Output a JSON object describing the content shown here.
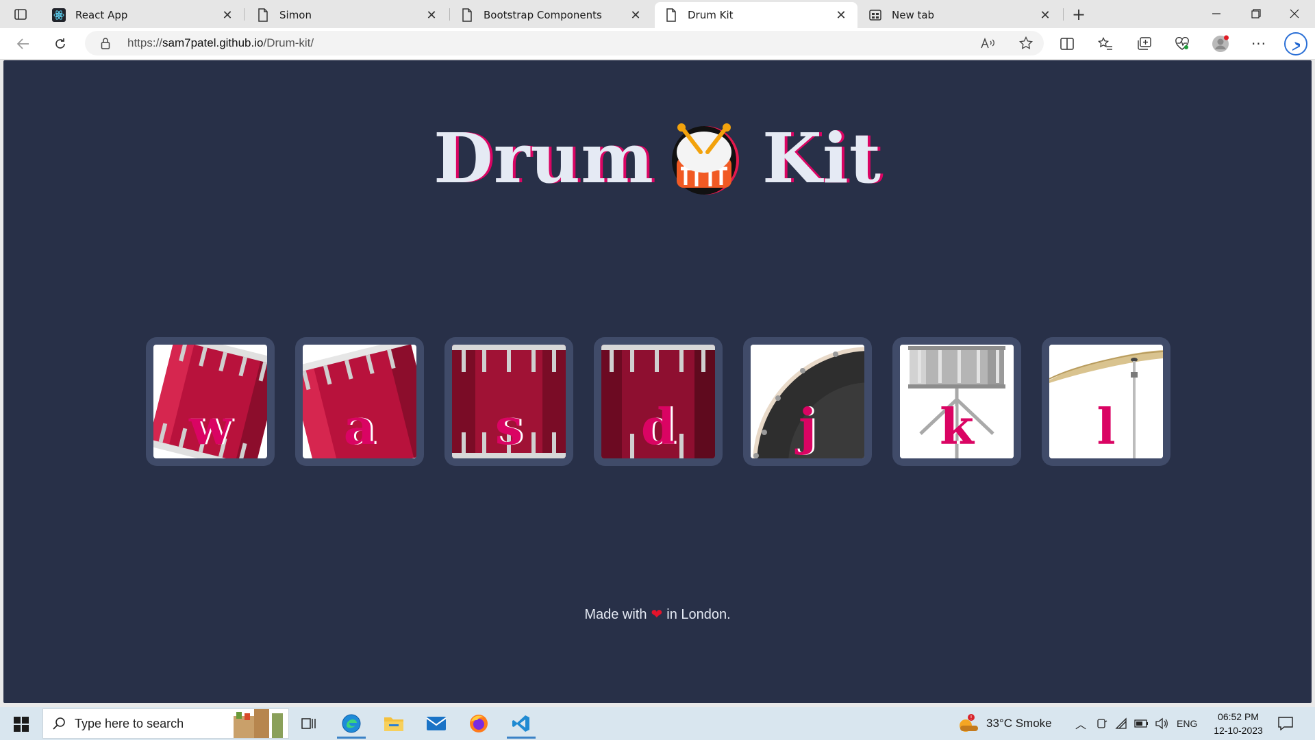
{
  "browser": {
    "tabs": [
      {
        "title": "React App",
        "icon": "react-icon",
        "active": false
      },
      {
        "title": "Simon",
        "icon": "page-icon",
        "active": false
      },
      {
        "title": "Bootstrap Components",
        "icon": "page-icon",
        "active": false
      },
      {
        "title": "Drum Kit",
        "icon": "page-icon",
        "active": true
      },
      {
        "title": "New tab",
        "icon": "newtab-icon",
        "active": false
      }
    ],
    "url_prefix": "https://",
    "url_host": "sam7patel.github.io",
    "url_path": "/Drum-kit/"
  },
  "page": {
    "title_left": "Drum",
    "title_right": "Kit",
    "drums": [
      {
        "key": "w",
        "image": "tom-drum-tilted"
      },
      {
        "key": "a",
        "image": "tom-drum-tilted"
      },
      {
        "key": "s",
        "image": "snare-drum-red"
      },
      {
        "key": "d",
        "image": "snare-drum-red"
      },
      {
        "key": "j",
        "image": "bass-drum-black"
      },
      {
        "key": "k",
        "image": "snare-drum-silver"
      },
      {
        "key": "l",
        "image": "cymbal"
      }
    ],
    "footer_before": "Made with",
    "footer_after": "in London."
  },
  "taskbar": {
    "search_placeholder": "Type here to search",
    "weather": "33°C  Smoke",
    "language": "ENG",
    "time": "06:52 PM",
    "date": "12-10-2023",
    "colors": {
      "accent": "#da0463",
      "page_bg": "#283048",
      "tile_bg": "#404b69"
    }
  }
}
